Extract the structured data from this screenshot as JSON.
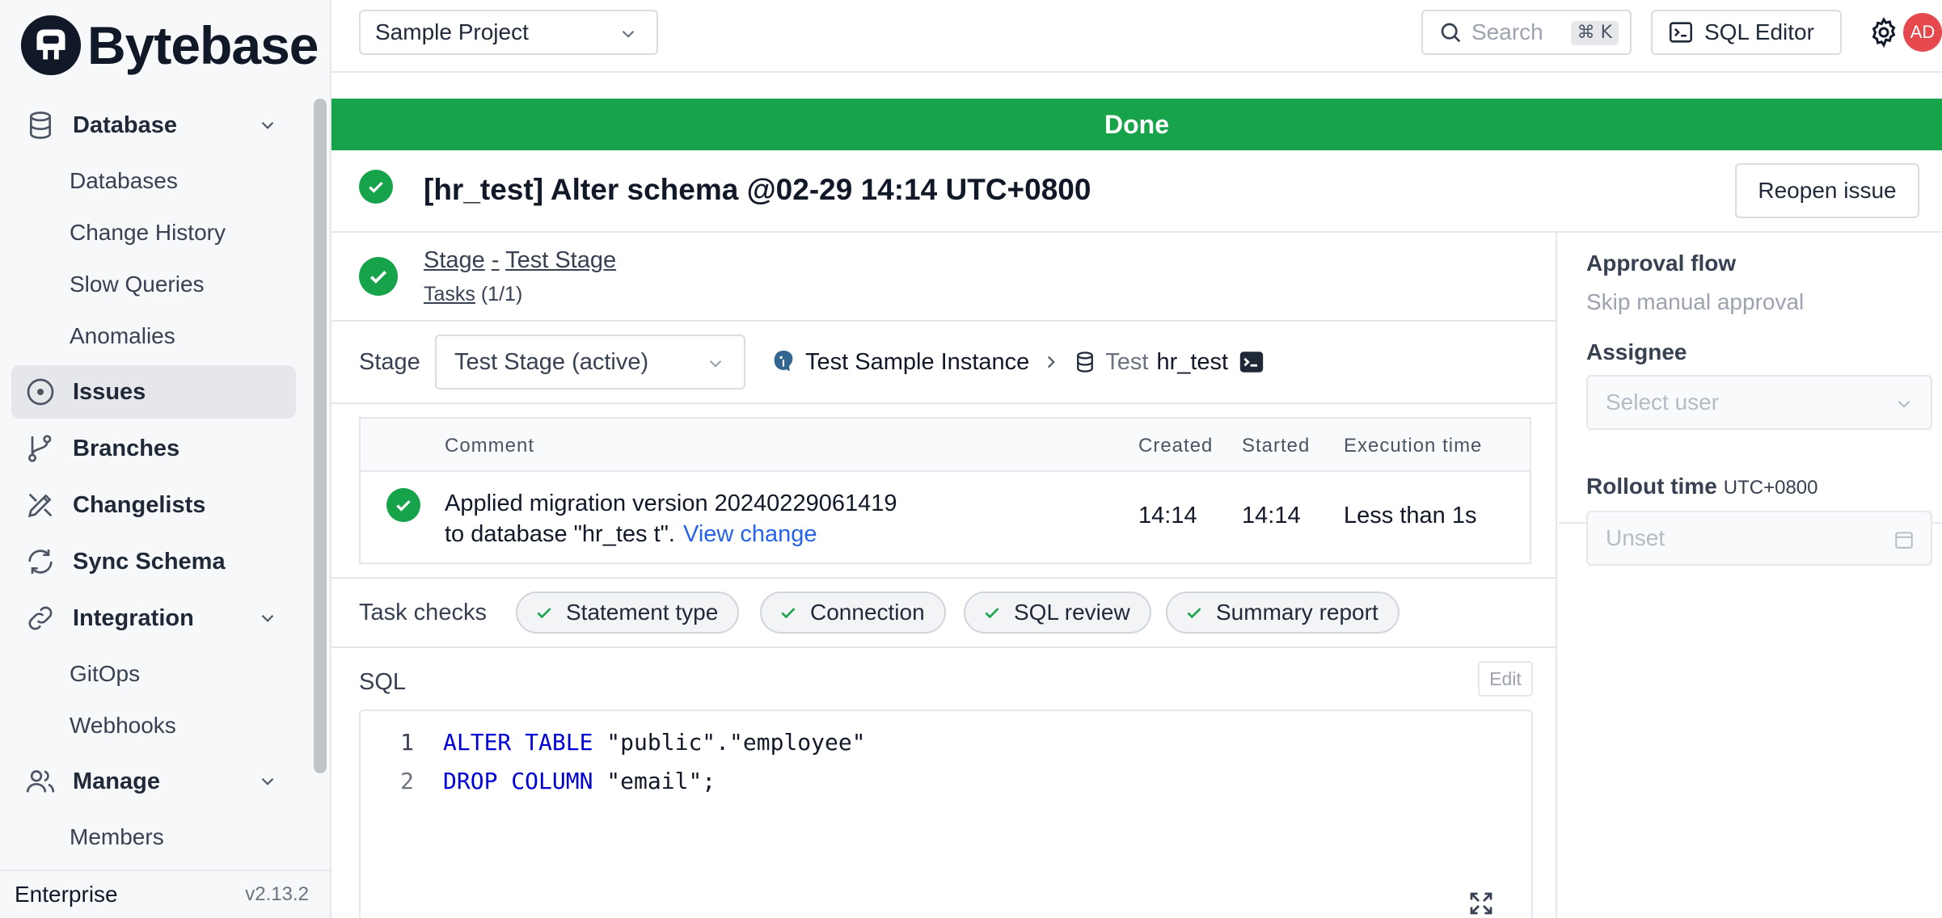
{
  "brand": {
    "name": "Bytebase"
  },
  "sidebar": {
    "groups": [
      {
        "label": "Database",
        "icon": "database-icon",
        "expandable": true,
        "children": [
          "Databases",
          "Change History",
          "Slow Queries",
          "Anomalies"
        ]
      },
      {
        "label": "Issues",
        "icon": "issues-icon",
        "active": true
      },
      {
        "label": "Branches",
        "icon": "branch-icon"
      },
      {
        "label": "Changelists",
        "icon": "changelist-icon"
      },
      {
        "label": "Sync Schema",
        "icon": "sync-icon"
      },
      {
        "label": "Integration",
        "icon": "link-icon",
        "expandable": true,
        "children": [
          "GitOps",
          "Webhooks"
        ]
      },
      {
        "label": "Manage",
        "icon": "users-icon",
        "expandable": true,
        "children": [
          "Members"
        ]
      }
    ],
    "footer": {
      "plan": "Enterprise",
      "version": "v2.13.2"
    }
  },
  "topbar": {
    "project": "Sample Project",
    "search_placeholder": "Search",
    "search_shortcut": "⌘ K",
    "sql_editor_label": "SQL Editor",
    "avatar_initials": "AD"
  },
  "issue": {
    "status_banner": "Done",
    "title": "[hr_test] Alter schema @02-29 14:14 UTC+0800",
    "reopen_label": "Reopen issue",
    "stage_link_prefix": "Stage",
    "stage_link_sep": "-",
    "stage_link_name": "Test Stage",
    "tasks_label": "Tasks",
    "tasks_count": "(1/1)",
    "stage_field_label": "Stage",
    "stage_selected": "Test Stage (active)",
    "instance": "Test Sample Instance",
    "environment": "Test",
    "database": "hr_test"
  },
  "task_table": {
    "headers": {
      "comment": "Comment",
      "created": "Created",
      "started": "Started",
      "execution_time": "Execution time"
    },
    "rows": [
      {
        "comment": "Applied migration version 20240229061419 to database \"hr_tes t\".",
        "link": "View change",
        "created": "14:14",
        "started": "14:14",
        "execution_time": "Less than 1s"
      }
    ]
  },
  "task_checks": {
    "label": "Task checks",
    "items": [
      "Statement type",
      "Connection",
      "SQL review",
      "Summary report"
    ]
  },
  "sql": {
    "label": "SQL",
    "edit_label": "Edit",
    "lines": [
      {
        "num": "1",
        "kw": "ALTER TABLE",
        "rest": " \"public\".\"employee\""
      },
      {
        "num": "2",
        "kw": "DROP COLUMN",
        "rest": " \"email\";"
      }
    ]
  },
  "side_panel": {
    "approval_label": "Approval flow",
    "approval_value": "Skip manual approval",
    "assignee_label": "Assignee",
    "assignee_placeholder": "Select user",
    "rollout_label": "Rollout time",
    "rollout_tz": "UTC+0800",
    "rollout_placeholder": "Unset"
  },
  "colors": {
    "success": "#16a34a",
    "link": "#2563eb",
    "sql_keyword": "#0000d6",
    "avatar": "#e5484d"
  }
}
